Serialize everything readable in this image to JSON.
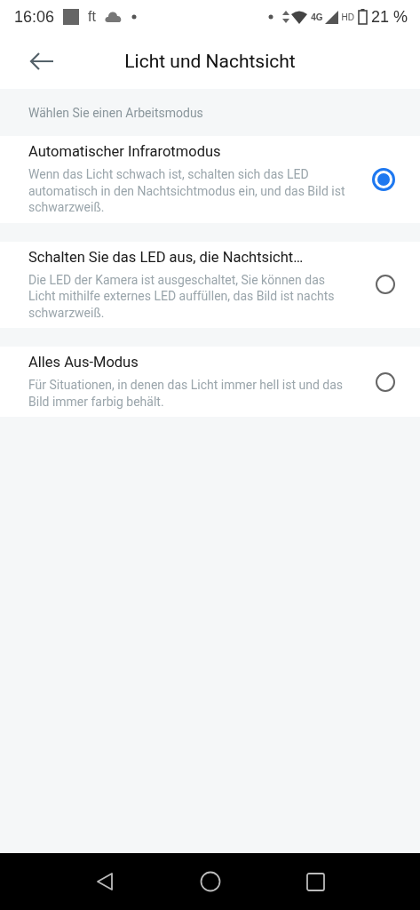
{
  "status_bar": {
    "time": "16:06",
    "app_label": "ft",
    "network_type": "4G",
    "hd_label": "HD",
    "battery": "21 %"
  },
  "header": {
    "title": "Licht und Nachtsicht"
  },
  "section_label": "Wählen Sie einen Arbeitsmodus",
  "modes": [
    {
      "title": "Automatischer Infrarotmodus",
      "description": "Wenn das Licht schwach ist, schalten sich das LED automatisch in den Nachtsichtmodus ein, und das Bild ist schwarzweiß.",
      "selected": true
    },
    {
      "title": "Schalten Sie das LED aus, die Nachtsicht…",
      "description": "Die LED der Kamera ist ausgeschaltet, Sie können das Licht mithilfe externes LED auffüllen, das Bild ist nachts schwarzweiß.",
      "selected": false
    },
    {
      "title": "Alles Aus-Modus",
      "description": "Für Situationen, in denen das Licht immer hell ist und das Bild immer farbig behält.",
      "selected": false
    }
  ]
}
